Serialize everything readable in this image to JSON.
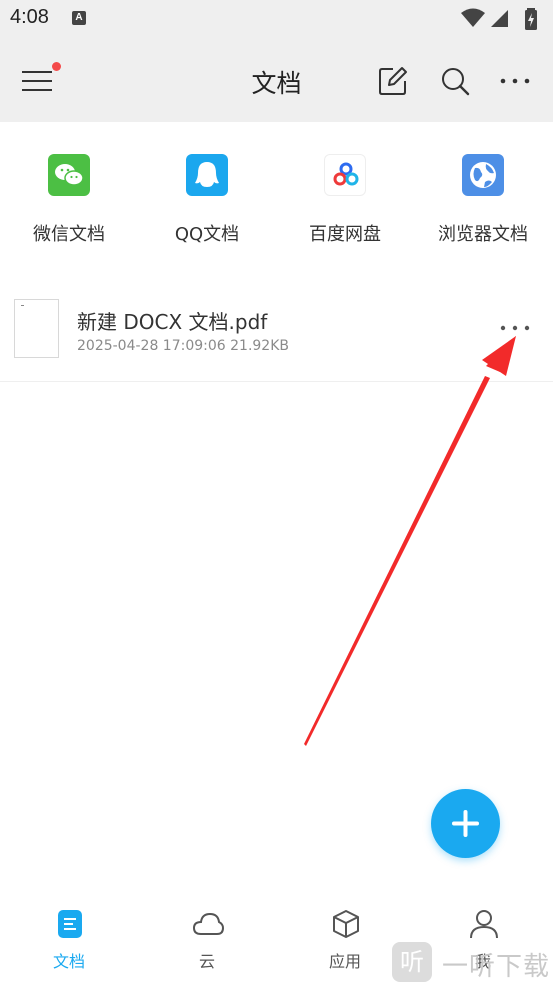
{
  "status_bar": {
    "time": "4:08",
    "notification_glyph": "A"
  },
  "header": {
    "title": "文档"
  },
  "sources": [
    {
      "label": "微信文档",
      "icon": "wechat-icon",
      "color": "#4cbf44"
    },
    {
      "label": "QQ文档",
      "icon": "qq-icon",
      "color": "#1ba7ee"
    },
    {
      "label": "百度网盘",
      "icon": "baidu-netdisk-icon",
      "color": "#ffffff"
    },
    {
      "label": "浏览器文档",
      "icon": "browser-icon",
      "color": "#4d8fe6"
    }
  ],
  "files": [
    {
      "name": "新建 DOCX 文档.pdf",
      "meta": "2025-04-28 17:09:06 21.92KB"
    }
  ],
  "bottom_nav": [
    {
      "label": "文档",
      "icon": "document-icon",
      "active": true
    },
    {
      "label": "云",
      "icon": "cloud-icon",
      "active": false
    },
    {
      "label": "应用",
      "icon": "apps-cube-icon",
      "active": false
    },
    {
      "label": "我",
      "icon": "person-icon",
      "active": false
    }
  ],
  "watermark": {
    "glyph": "听",
    "text": "一听下载"
  },
  "colors": {
    "accent": "#1aa9f0",
    "header_bg": "#efefef",
    "badge_red": "#f44a4a",
    "annotation_red": "#f22a2a"
  }
}
